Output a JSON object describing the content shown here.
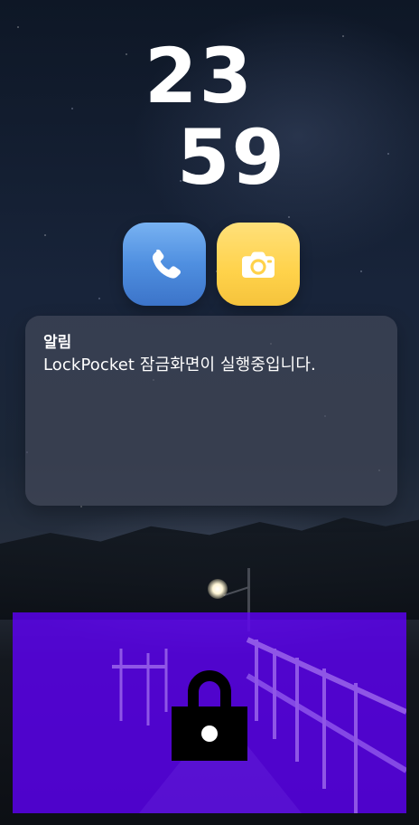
{
  "app": {
    "name": "LockPocket"
  },
  "clock": {
    "hours": "23",
    "minutes": "59"
  },
  "shortcuts": [
    {
      "name": "phone",
      "icon": "phone-icon",
      "color": "#4f8fe0"
    },
    {
      "name": "camera",
      "icon": "camera-icon",
      "color": "#ffd24a"
    }
  ],
  "notification": {
    "title": "알림",
    "body": "LockPocket 잠금화면이 실행중입니다."
  },
  "unlock": {
    "icon": "padlock-icon",
    "panel_color": "#6200ff"
  }
}
